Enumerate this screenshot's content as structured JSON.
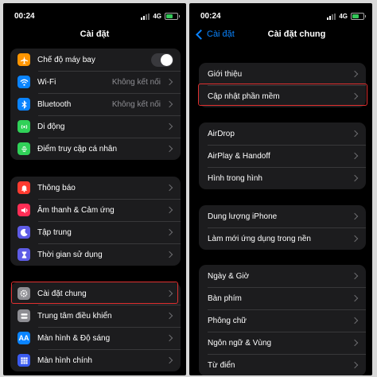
{
  "status": {
    "time": "00:24",
    "network": "4G"
  },
  "left": {
    "title": "Cài đặt",
    "group1": [
      {
        "label": "Chế độ máy bay",
        "icon": "airplane-icon",
        "color": "#ff9500",
        "toggle": true
      },
      {
        "label": "Wi-Fi",
        "icon": "wifi-icon",
        "color": "#0a84ff",
        "value": "Không kết nối"
      },
      {
        "label": "Bluetooth",
        "icon": "bluetooth-icon",
        "color": "#0a84ff",
        "value": "Không kết nối"
      },
      {
        "label": "Di động",
        "icon": "cellular-icon",
        "color": "#30d158"
      },
      {
        "label": "Điểm truy cập cá nhân",
        "icon": "hotspot-icon",
        "color": "#30d158"
      }
    ],
    "group2": [
      {
        "label": "Thông báo",
        "icon": "bell-icon",
        "color": "#ff3b30"
      },
      {
        "label": "Âm thanh & Cảm ứng",
        "icon": "speaker-icon",
        "color": "#ff2d55"
      },
      {
        "label": "Tập trung",
        "icon": "moon-icon",
        "color": "#5e5ce6"
      },
      {
        "label": "Thời gian sử dụng",
        "icon": "hourglass-icon",
        "color": "#5e5ce6"
      }
    ],
    "group3": [
      {
        "label": "Cài đặt chung",
        "icon": "gear-icon",
        "color": "#8e8e93"
      },
      {
        "label": "Trung tâm điều khiển",
        "icon": "control-center-icon",
        "color": "#8e8e93"
      },
      {
        "label": "Màn hình & Độ sáng",
        "icon": "display-icon",
        "color": "#0a84ff"
      },
      {
        "label": "Màn hình chính",
        "icon": "home-screen-icon",
        "color": "#3a5bf0"
      }
    ]
  },
  "right": {
    "back_label": "Cài đặt",
    "title": "Cài đặt chung",
    "group1": [
      "Giới thiệu",
      "Cập nhật phần mềm"
    ],
    "group2": [
      "AirDrop",
      "AirPlay & Handoff",
      "Hình trong hình"
    ],
    "group3": [
      "Dung lượng iPhone",
      "Làm mới ứng dụng trong nền"
    ],
    "group4": [
      "Ngày & Giờ",
      "Bàn phím",
      "Phông chữ",
      "Ngôn ngữ & Vùng",
      "Từ điển"
    ]
  },
  "highlight_color": "#e03030"
}
